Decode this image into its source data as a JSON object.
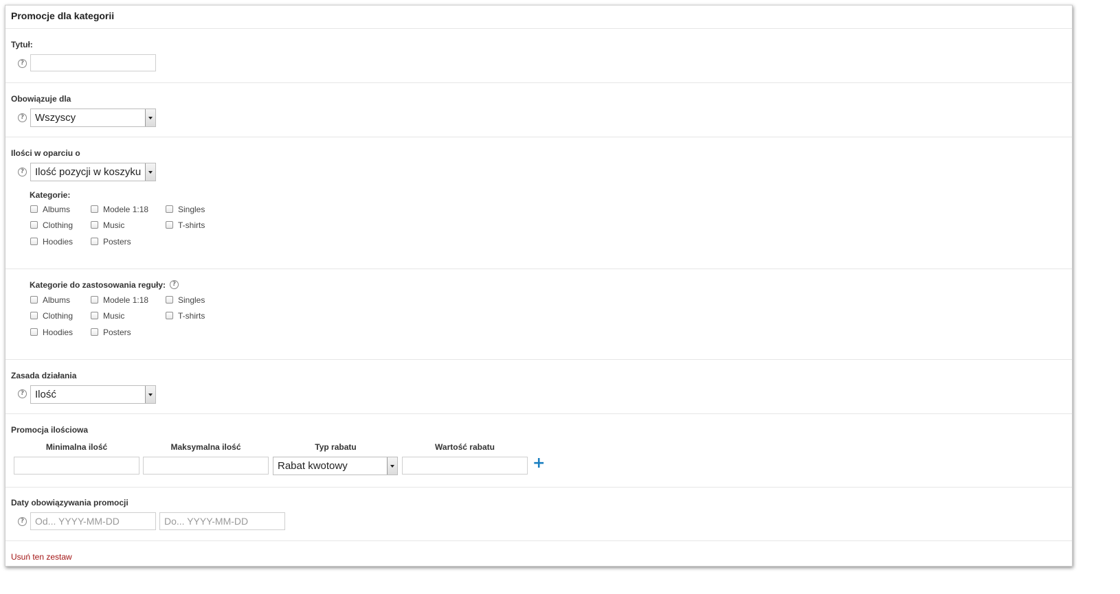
{
  "panel": {
    "title": "Promocje dla kategorii"
  },
  "tytul": {
    "label": "Tytuł:",
    "value": ""
  },
  "obowiazuje": {
    "label": "Obowiązuje dla",
    "selected": "Wszyscy"
  },
  "ilosci": {
    "label": "Ilości w oparciu o",
    "selected": "Ilość pozycji w koszyku"
  },
  "kategorie": {
    "label": "Kategorie:",
    "items": [
      "Albums",
      "Clothing",
      "Hoodies",
      "Modele 1:18",
      "Music",
      "Posters",
      "Singles",
      "T-shirts"
    ]
  },
  "kategorie_regula": {
    "label": "Kategorie do zastosowania reguły:",
    "items": [
      "Albums",
      "Clothing",
      "Hoodies",
      "Modele 1:18",
      "Music",
      "Posters",
      "Singles",
      "T-shirts"
    ]
  },
  "zasada": {
    "label": "Zasada działania",
    "selected": "Ilość"
  },
  "promocja": {
    "label": "Promocja ilościowa",
    "columns": [
      "Minimalna ilość",
      "Maksymalna ilość",
      "Typ rabatu",
      "Wartość rabatu"
    ],
    "typ_selected": "Rabat kwotowy",
    "add": "+"
  },
  "daty": {
    "label": "Daty obowiązywania promocji",
    "from_placeholder": "Od... YYYY-MM-DD",
    "to_placeholder": "Do... YYYY-MM-DD"
  },
  "remove_link": "Usuń ten zestaw",
  "help_glyph": "?",
  "colors": {
    "accent": "#1a7fc1",
    "danger": "#a31515"
  }
}
